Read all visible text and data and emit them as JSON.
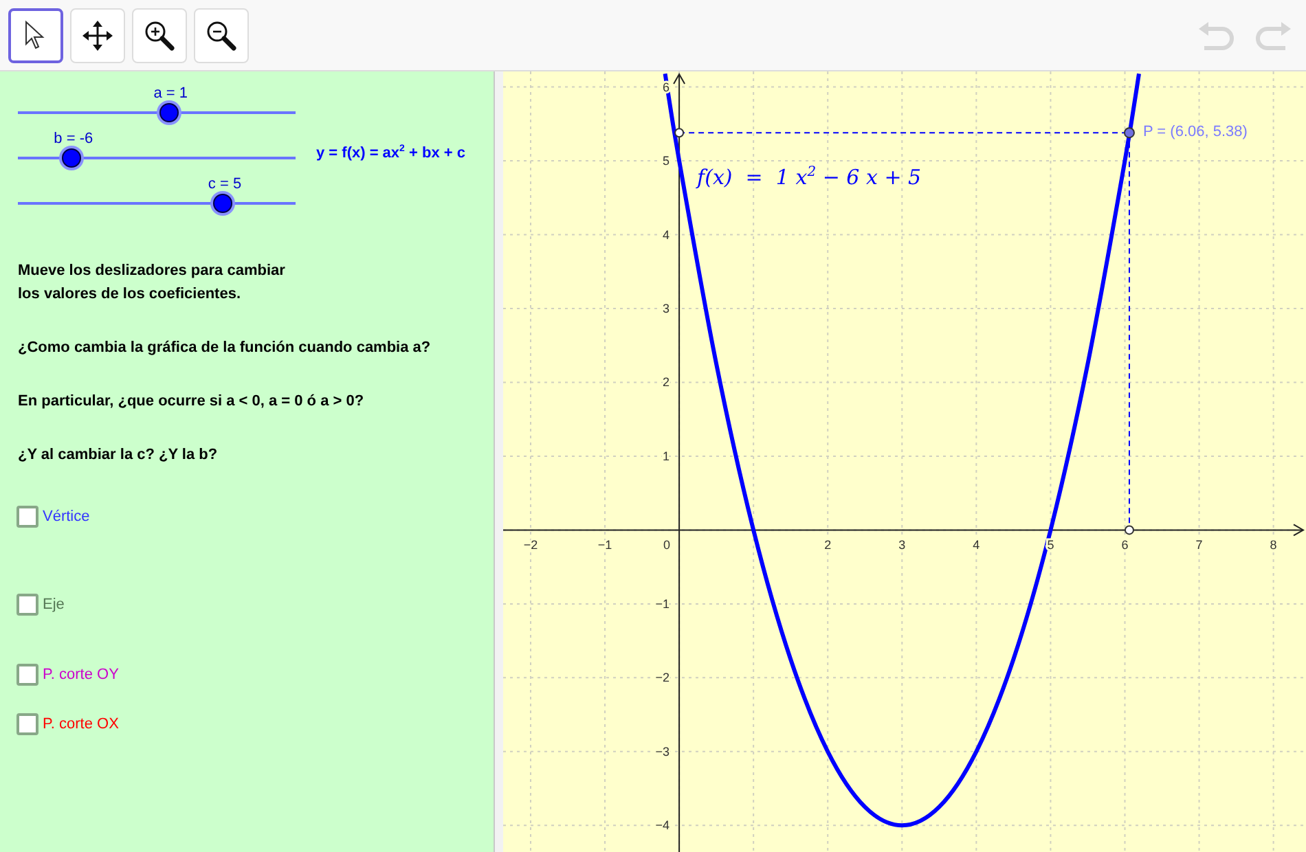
{
  "toolbar": {
    "tools": [
      {
        "kind": "pointer",
        "selected": true
      },
      {
        "kind": "move",
        "selected": false
      },
      {
        "kind": "zoom-in",
        "selected": false
      },
      {
        "kind": "zoom-out",
        "selected": false
      }
    ],
    "history": [
      {
        "kind": "undo",
        "disabled": true
      },
      {
        "kind": "redo",
        "disabled": true
      }
    ]
  },
  "sliders": [
    {
      "label": "a = 1",
      "level": 0.55
    },
    {
      "label": "b = -6",
      "level": 0.2
    },
    {
      "label": "c = 5",
      "level": 0.745
    }
  ],
  "equation": "y = f(x) = ax$^{2}$ + bx + c",
  "instructions": [
    "Mueve los deslizadores para cambiar\nlos valores de los coeficientes.",
    "¿Como cambia la gráfica de la función cuando cambia a?",
    "En particular, ¿que ocurre si a < 0, a = 0 ó a > 0?",
    "¿Y al cambiar la c? ¿Y la b?"
  ],
  "checkboxes": [
    {
      "label": "Vértice",
      "checked": false,
      "color": "#3333ff"
    },
    {
      "label": "Eje",
      "checked": false,
      "color": "#557755"
    },
    {
      "label": "P. corte OY",
      "checked": false,
      "color": "#cc00cc"
    },
    {
      "label": "P. corte OX",
      "checked": false,
      "color": "#ff0000"
    }
  ],
  "graph": {
    "point": {
      "label": "P = (6.06, 5.38)"
    },
    "origin_label": "0",
    "chart_data": {
      "type": "line",
      "x": [
        -0.19,
        0,
        0.5,
        1,
        1.5,
        2,
        2.5,
        3,
        3.5,
        4,
        4.5,
        5,
        5.5,
        6,
        6.19
      ],
      "series": [
        {
          "name": "f(x)  =  1 x$^{2}$ − 6 x + 5",
          "color": "#0000ff",
          "values": [
            6.18,
            5,
            2.25,
            0,
            -1.75,
            -3,
            -3.75,
            -4,
            -3.75,
            -3,
            -1.75,
            0,
            2.25,
            5,
            6.18
          ]
        }
      ],
      "grid": true,
      "xlim": [
        -2.37,
        8.42
      ],
      "ylim": [
        -4.36,
        6.21
      ],
      "xticks": [
        {
          "value": -2,
          "label": "−2"
        },
        {
          "value": -1,
          "label": "−1"
        },
        {
          "value": 2,
          "label": "2"
        },
        {
          "value": 3,
          "label": "3"
        },
        {
          "value": 4,
          "label": "4"
        },
        {
          "value": 5,
          "label": "5"
        },
        {
          "value": 6,
          "label": "6"
        },
        {
          "value": 7,
          "label": "7"
        },
        {
          "value": 8,
          "label": "8"
        }
      ],
      "yticks": [
        {
          "value": -4,
          "label": "−4"
        },
        {
          "value": -3,
          "label": "−3"
        },
        {
          "value": -2,
          "label": "−2"
        },
        {
          "value": -1,
          "label": "−1"
        },
        {
          "value": 1,
          "label": "1"
        },
        {
          "value": 2,
          "label": "2"
        },
        {
          "value": 3,
          "label": "3"
        },
        {
          "value": 4,
          "label": "4"
        },
        {
          "value": 5,
          "label": "5"
        },
        {
          "value": 6,
          "label": "6"
        }
      ]
    }
  }
}
